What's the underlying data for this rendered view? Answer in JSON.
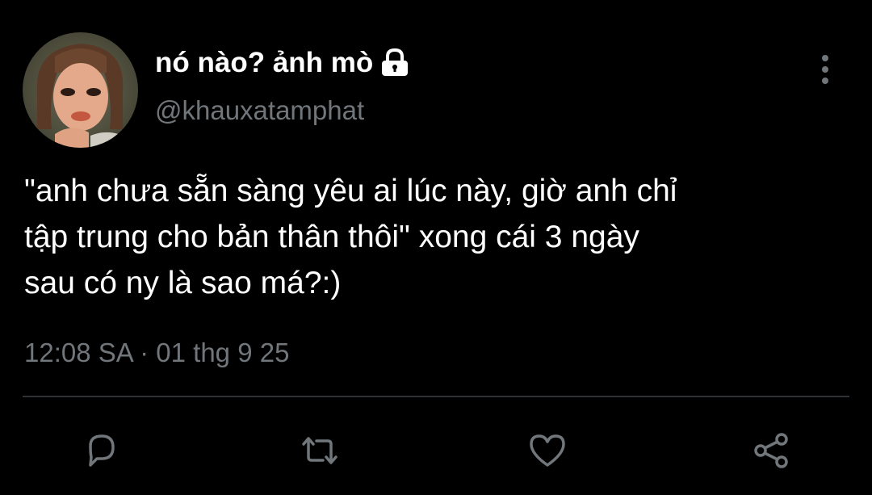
{
  "tweet": {
    "display_name": "nó nào? ảnh mò",
    "handle": "@khauxatamphat",
    "text_lines": [
      "\"anh chưa sẵn sàng yêu ai lúc này, giờ anh chỉ",
      "tập trung cho bản thân thôi\" xong cái 3 ngày",
      "sau có ny là sao má?:)"
    ],
    "timestamp": "12:08 SA · 01 thg 9 25"
  },
  "icons": {
    "lock": "lock-icon",
    "more": "more-vertical-icon",
    "reply": "reply-icon",
    "retweet": "retweet-icon",
    "like": "heart-icon",
    "share": "share-icon"
  },
  "colors": {
    "background": "#000000",
    "text": "#ffffff",
    "secondary": "#71767b",
    "divider": "#2f3336"
  }
}
